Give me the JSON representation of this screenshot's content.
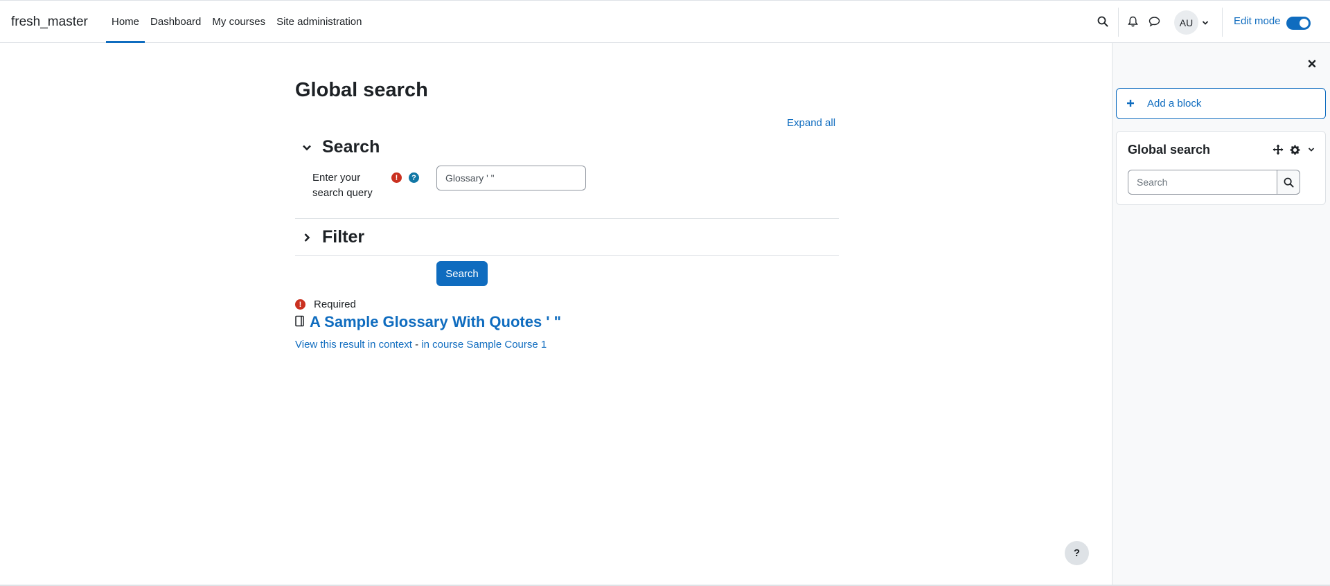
{
  "navbar": {
    "brand": "fresh_master",
    "nav_items": [
      {
        "label": "Home",
        "active": true
      },
      {
        "label": "Dashboard",
        "active": false
      },
      {
        "label": "My courses",
        "active": false
      },
      {
        "label": "Site administration",
        "active": false
      }
    ],
    "avatar_initials": "AU",
    "edit_mode_label": "Edit mode",
    "edit_mode_on": true
  },
  "main": {
    "page_title": "Global search",
    "expand_all_label": "Expand all",
    "search_section_title": "Search",
    "query_label": "Enter your search query",
    "query_value": "Glossary ' \"",
    "filter_section_title": "Filter",
    "search_button_label": "Search",
    "required_label": "Required",
    "result": {
      "title": "A Sample Glossary With Quotes ' \"",
      "view_in_context": "View this result in context",
      "separator": " - ",
      "course_link": "in course Sample Course 1"
    }
  },
  "drawer": {
    "add_block_label": "Add a block",
    "block_title": "Global search",
    "block_search_placeholder": "Search"
  },
  "help_fab_label": "?",
  "colors": {
    "accent": "#0f6cbf",
    "required": "#ca3120",
    "help": "#1177a5"
  }
}
